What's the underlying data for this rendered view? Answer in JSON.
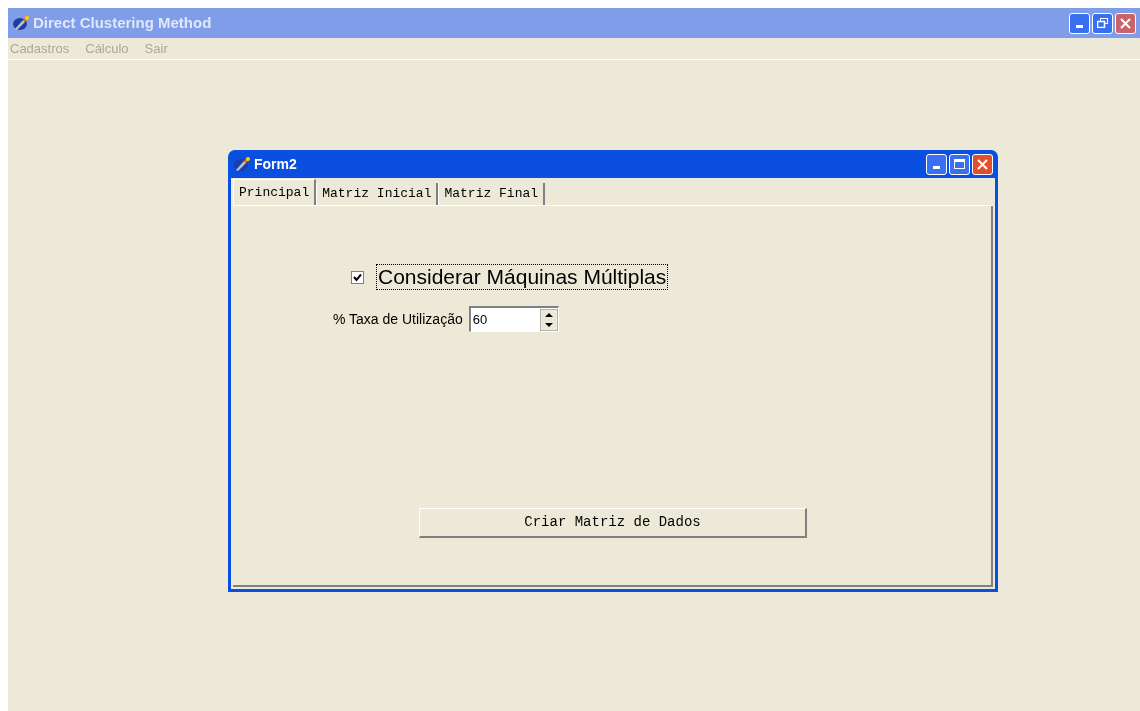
{
  "main_window": {
    "title": "Direct Clustering Method"
  },
  "menu": [
    {
      "label": "Cadastros",
      "disabled": true
    },
    {
      "label": "Cálculo",
      "disabled": true
    },
    {
      "label": "Sair",
      "disabled": true
    }
  ],
  "form": {
    "title": "Form2",
    "tabs": [
      {
        "label": "Principal",
        "selected": true
      },
      {
        "label": "Matriz Inicial",
        "selected": false
      },
      {
        "label": "Matriz Final",
        "selected": false
      }
    ],
    "checkbox": {
      "label": "Considerar Máquinas Múltiplas",
      "checked": true
    },
    "spinner": {
      "label": "% Taxa de Utilização",
      "value": "60"
    },
    "button": "Criar Matriz de Dados"
  }
}
